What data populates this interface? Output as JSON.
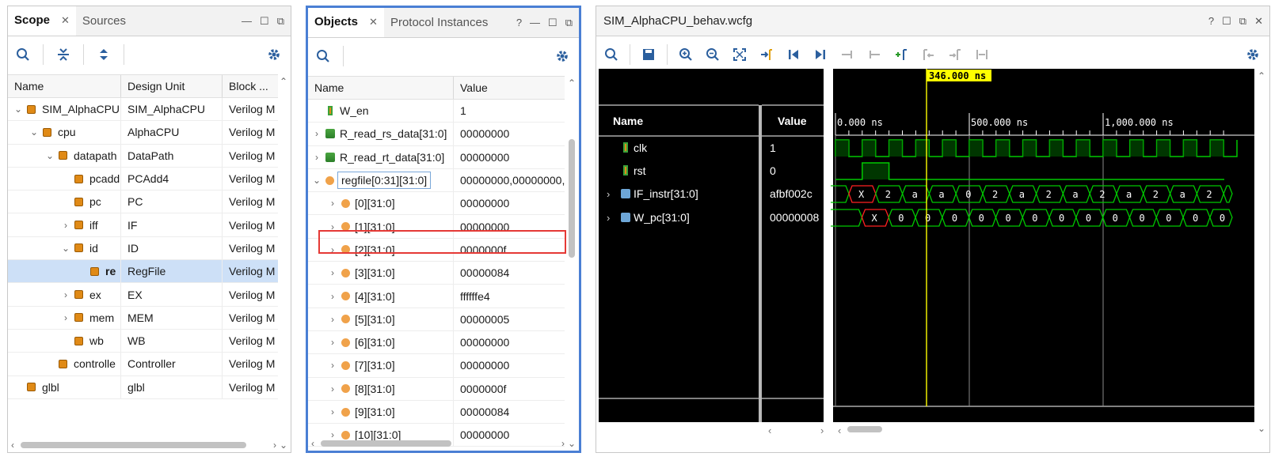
{
  "scope": {
    "tabs": [
      "Scope",
      "Sources"
    ],
    "columns": [
      "Name",
      "Design Unit",
      "Block ..."
    ],
    "rows": [
      {
        "name": "SIM_AlphaCPU",
        "unit": "SIM_AlphaCPU",
        "block": "Verilog M",
        "indent": 0,
        "chev": "v"
      },
      {
        "name": "cpu",
        "unit": "AlphaCPU",
        "block": "Verilog M",
        "indent": 1,
        "chev": "v"
      },
      {
        "name": "datapath",
        "unit": "DataPath",
        "block": "Verilog M",
        "indent": 2,
        "chev": "v"
      },
      {
        "name": "pcadd",
        "unit": "PCAdd4",
        "block": "Verilog M",
        "indent": 3,
        "chev": ""
      },
      {
        "name": "pc",
        "unit": "PC",
        "block": "Verilog M",
        "indent": 3,
        "chev": ""
      },
      {
        "name": "iff",
        "unit": "IF",
        "block": "Verilog M",
        "indent": 3,
        "chev": ">"
      },
      {
        "name": "id",
        "unit": "ID",
        "block": "Verilog M",
        "indent": 3,
        "chev": "v"
      },
      {
        "name": "re",
        "unit": "RegFile",
        "block": "Verilog M",
        "indent": 4,
        "chev": "",
        "selected": true
      },
      {
        "name": "ex",
        "unit": "EX",
        "block": "Verilog M",
        "indent": 3,
        "chev": ">"
      },
      {
        "name": "mem",
        "unit": "MEM",
        "block": "Verilog M",
        "indent": 3,
        "chev": ">"
      },
      {
        "name": "wb",
        "unit": "WB",
        "block": "Verilog M",
        "indent": 3,
        "chev": ""
      },
      {
        "name": "controlle",
        "unit": "Controller",
        "block": "Verilog M",
        "indent": 2,
        "chev": ""
      },
      {
        "name": "glbl",
        "unit": "glbl",
        "block": "Verilog M",
        "indent": 0,
        "chev": ""
      }
    ]
  },
  "objects": {
    "tabs": [
      "Objects",
      "Protocol Instances"
    ],
    "columns": [
      "Name",
      "Value"
    ],
    "rows": [
      {
        "name": "W_en",
        "value": "1",
        "kind": "bit",
        "chev": "",
        "indent": 0
      },
      {
        "name": "R_read_rs_data[31:0]",
        "value": "00000000",
        "kind": "bus",
        "chev": ">",
        "indent": 0
      },
      {
        "name": "R_read_rt_data[31:0]",
        "value": "00000000",
        "kind": "bus",
        "chev": ">",
        "indent": 0
      },
      {
        "name": "regfile[0:31][31:0]",
        "value": "00000000,00000000,",
        "kind": "arr",
        "chev": "v",
        "indent": 0,
        "boxed": true
      },
      {
        "name": "[0][31:0]",
        "value": "00000000",
        "kind": "arr",
        "chev": ">",
        "indent": 1
      },
      {
        "name": "[1][31:0]",
        "value": "00000000",
        "kind": "arr",
        "chev": ">",
        "indent": 1
      },
      {
        "name": "[2][31:0]",
        "value": "0000000f",
        "kind": "arr",
        "chev": ">",
        "indent": 1,
        "highlight": true
      },
      {
        "name": "[3][31:0]",
        "value": "00000084",
        "kind": "arr",
        "chev": ">",
        "indent": 1
      },
      {
        "name": "[4][31:0]",
        "value": "ffffffe4",
        "kind": "arr",
        "chev": ">",
        "indent": 1
      },
      {
        "name": "[5][31:0]",
        "value": "00000005",
        "kind": "arr",
        "chev": ">",
        "indent": 1
      },
      {
        "name": "[6][31:0]",
        "value": "00000000",
        "kind": "arr",
        "chev": ">",
        "indent": 1
      },
      {
        "name": "[7][31:0]",
        "value": "00000000",
        "kind": "arr",
        "chev": ">",
        "indent": 1
      },
      {
        "name": "[8][31:0]",
        "value": "0000000f",
        "kind": "arr",
        "chev": ">",
        "indent": 1
      },
      {
        "name": "[9][31:0]",
        "value": "00000084",
        "kind": "arr",
        "chev": ">",
        "indent": 1
      },
      {
        "name": "[10][31:0]",
        "value": "00000000",
        "kind": "arr",
        "chev": ">",
        "indent": 1
      }
    ]
  },
  "wave": {
    "title": "SIM_AlphaCPU_behav.wcfg",
    "columns": [
      "Name",
      "Value"
    ],
    "cursor_label": "346.000 ns",
    "time_labels": [
      "0.000 ns",
      "500.000 ns",
      "1,000.000 ns"
    ],
    "signals": [
      {
        "name": "clk",
        "value": "1",
        "kind": "bit",
        "chev": ""
      },
      {
        "name": "rst",
        "value": "0",
        "kind": "bit",
        "chev": ""
      },
      {
        "name": "IF_instr[31:0]",
        "value": "afbf002c",
        "kind": "bus",
        "chev": ">"
      },
      {
        "name": "W_pc[31:0]",
        "value": "00000008",
        "kind": "bus",
        "chev": ">"
      }
    ],
    "instr_labels": [
      "X",
      "2",
      "a",
      "a",
      "0",
      "2",
      "a",
      "2",
      "a",
      "2",
      "a",
      "2",
      "a",
      "2"
    ],
    "pc_labels": [
      "X",
      "0",
      "0",
      "0",
      "0",
      "0",
      "0",
      "0",
      "0",
      "0",
      "0",
      "0",
      "0",
      "0"
    ]
  },
  "colors": {
    "wave_green": "#00c800",
    "cursor": "#ffff00",
    "x_red": "#ff2020",
    "highlight": "#e53935",
    "active_border": "#4a7fd4"
  }
}
